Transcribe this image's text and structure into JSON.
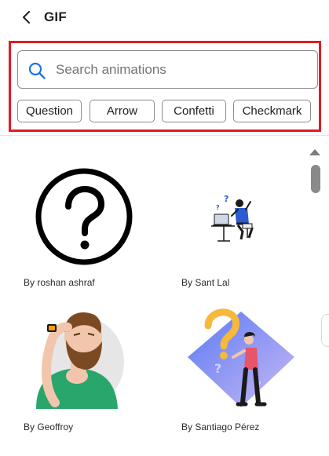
{
  "header": {
    "title": "GIF",
    "back_icon": "chevron-left-icon"
  },
  "search": {
    "placeholder": "Search animations",
    "value": "",
    "icon": "search-icon",
    "accent": "#1a73e8"
  },
  "suggestions": [
    "Question",
    "Arrow",
    "Confetti",
    "Checkmark"
  ],
  "highlight_color": "#e11b22",
  "results": [
    {
      "author": "By roshan ashraf",
      "thumbnail": "question-mark-circle"
    },
    {
      "author": "By Sant Lal",
      "thumbnail": "person-confused-at-laptop"
    },
    {
      "author": "By Geoffroy",
      "thumbnail": "bearded-man-thinking"
    },
    {
      "author": "By Santiago Pérez",
      "thumbnail": "man-with-question-mark"
    }
  ]
}
